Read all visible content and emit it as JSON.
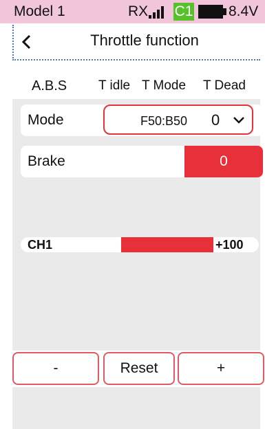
{
  "status": {
    "model": "Model 1",
    "rx": "RX",
    "channel_badge": "C1",
    "voltage": "8.4V",
    "icons": {
      "signal": "signal-bars-icon",
      "battery": "battery-icon"
    }
  },
  "header": {
    "title": "Throttle function",
    "back_icon": "chevron-left-icon"
  },
  "tabs": [
    {
      "label": "A.B.S",
      "selected": false
    },
    {
      "label": "T idle",
      "selected": false
    },
    {
      "label": "T Mode",
      "selected": true
    },
    {
      "label": "T Dead",
      "selected": false
    }
  ],
  "mode": {
    "label": "Mode",
    "value": "F50:B50",
    "number": "0",
    "icon": "chevron-down-icon"
  },
  "brake": {
    "label": "Brake",
    "value": "0"
  },
  "channel": {
    "label": "CH1",
    "value": "+100",
    "level_percent": 100
  },
  "buttons": {
    "minus": "-",
    "reset": "Reset",
    "plus": "+"
  },
  "colors": {
    "accent": "#e8303a",
    "status_bar": "#f2c6da",
    "badge": "#57c12c",
    "panel": "#eaeaea"
  }
}
